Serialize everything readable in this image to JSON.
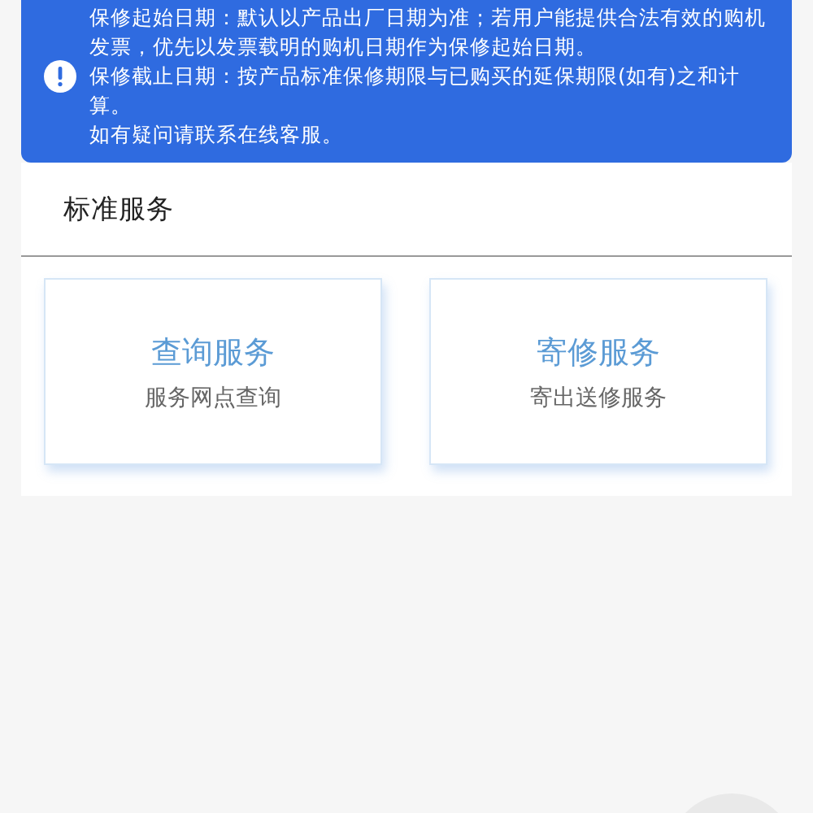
{
  "notice": {
    "paragraphs": [
      "保修起始日期：默认以产品出厂日期为准；若用户能提供合法有效的购机发票，优先以发票载明的购机日期作为保修起始日期。",
      "保修截止日期：按产品标准保修期限与已购买的延保期限(如有)之和计算。",
      "如有疑问请联系在线客服。"
    ]
  },
  "section": {
    "title": "标准服务",
    "cards": [
      {
        "title": "查询服务",
        "subtitle": "服务网点查询"
      },
      {
        "title": "寄修服务",
        "subtitle": "寄出送修服务"
      }
    ]
  }
}
